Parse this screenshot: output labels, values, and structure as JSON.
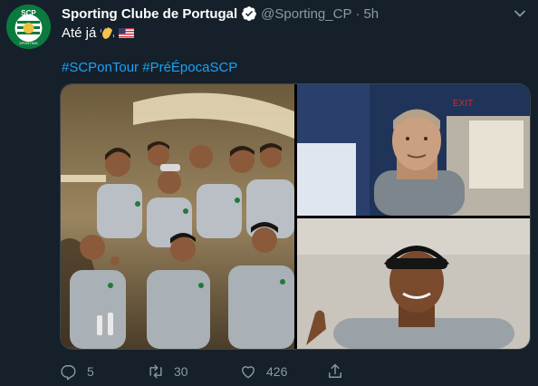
{
  "tweet": {
    "author_name": "Sporting Clube de Portugal",
    "handle": "@Sporting_CP",
    "separator": "·",
    "time": "5h",
    "text": "Até já",
    "hashtags": [
      "#SCPonTour",
      "#PréÉpocaSCP"
    ]
  },
  "avatar": {
    "logo_text": "SCP",
    "ring_text": "SPORTING"
  },
  "actions": {
    "replies": "5",
    "retweets": "30",
    "likes": "426"
  },
  "signs": {
    "exit": "EXIT"
  },
  "colors": {
    "background": "#15202b",
    "link": "#1da1f2",
    "muted": "#8899a6",
    "club_green": "#0a7a3e"
  }
}
